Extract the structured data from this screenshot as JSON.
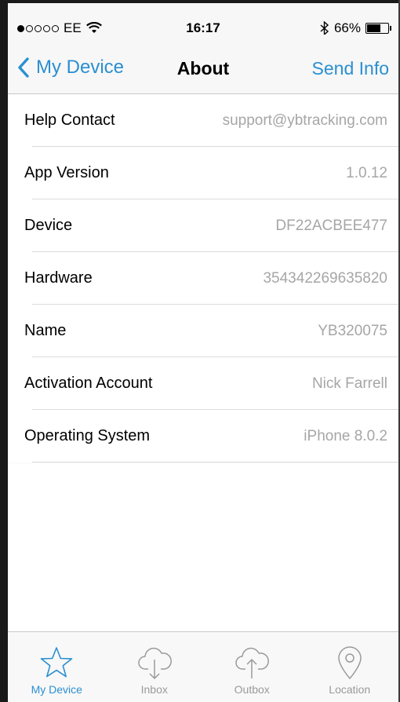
{
  "status_bar": {
    "carrier": "EE",
    "time": "16:17",
    "battery": "66%",
    "battery_level": 0.66
  },
  "nav": {
    "back_label": "My Device",
    "title": "About",
    "action_label": "Send Info"
  },
  "rows": [
    {
      "label": "Help Contact",
      "value": "support@ybtracking.com"
    },
    {
      "label": "App Version",
      "value": "1.0.12"
    },
    {
      "label": "Device",
      "value": "DF22ACBEE477"
    },
    {
      "label": "Hardware",
      "value": "354342269635820"
    },
    {
      "label": "Name",
      "value": "YB320075"
    },
    {
      "label": "Activation Account",
      "value": "Nick Farrell"
    },
    {
      "label": "Operating System",
      "value": "iPhone 8.0.2"
    }
  ],
  "tabs": [
    {
      "label": "My Device",
      "icon": "star-icon",
      "active": true
    },
    {
      "label": "Inbox",
      "icon": "cloud-download-icon",
      "active": false
    },
    {
      "label": "Outbox",
      "icon": "cloud-upload-icon",
      "active": false
    },
    {
      "label": "Location",
      "icon": "location-pin-icon",
      "active": false
    }
  ],
  "colors": {
    "accent": "#2a8fd1",
    "secondary_text": "#a6a6a6",
    "inactive_tab": "#9a9a9a"
  }
}
